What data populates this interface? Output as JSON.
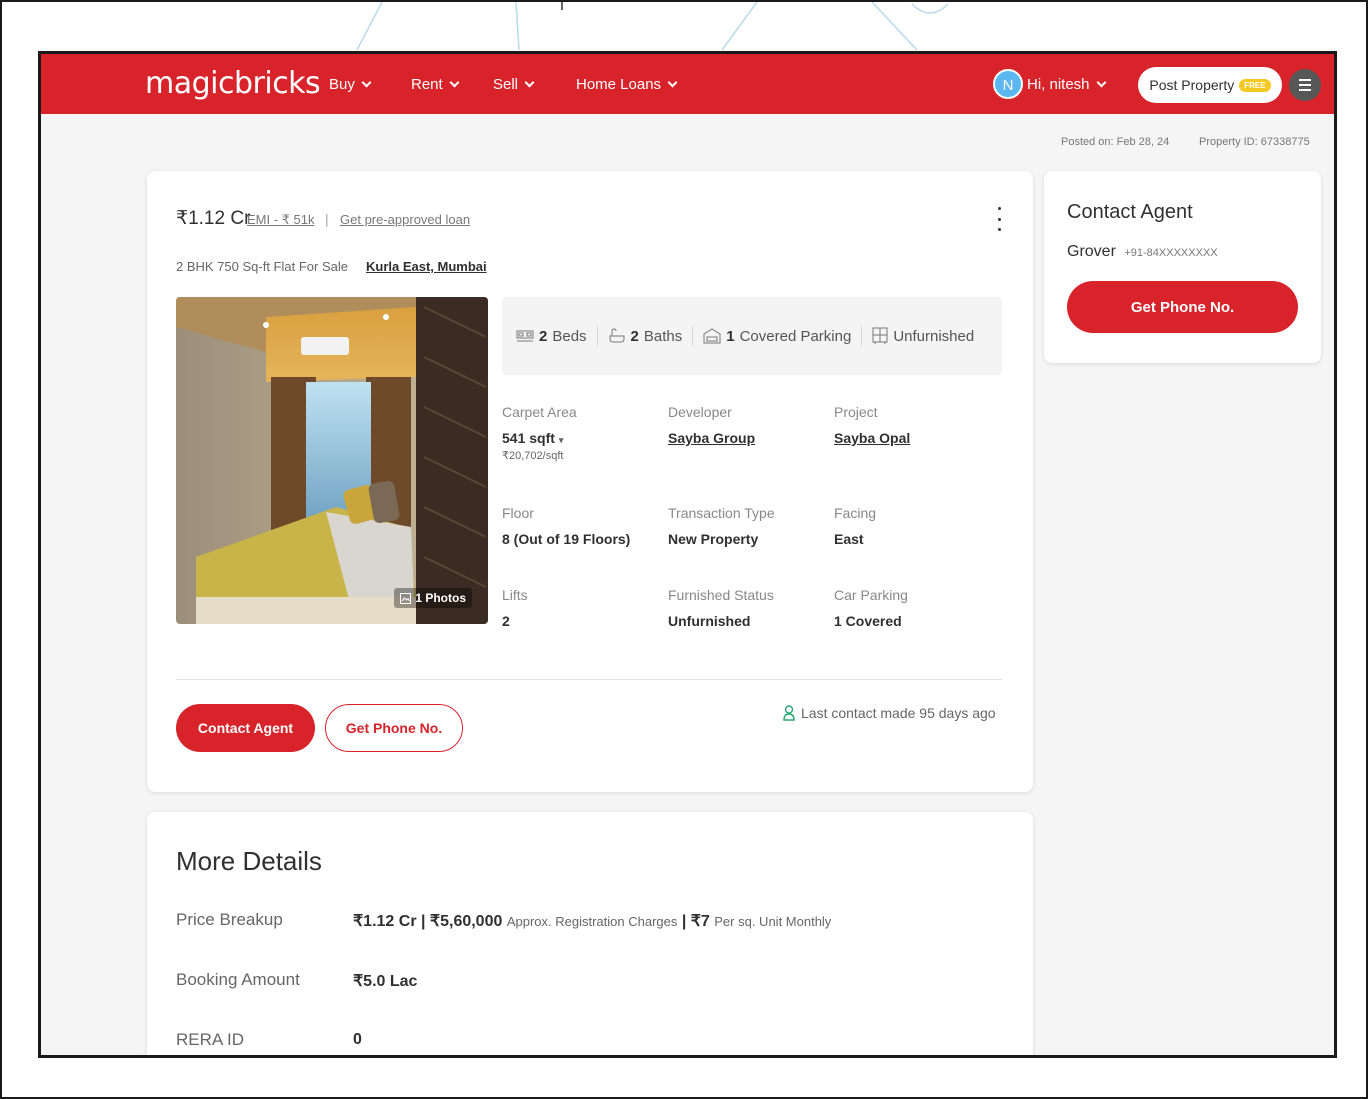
{
  "header": {
    "logo": "magicbricks",
    "nav": [
      "Buy",
      "Rent",
      "Sell",
      "Home Loans"
    ],
    "avatar_initial": "N",
    "greeting": "Hi, nitesh",
    "post_property": "Post Property",
    "free_badge": "FREE"
  },
  "meta": {
    "posted_on": "Posted on: Feb 28, 24",
    "property_id": "Property ID: 67338775"
  },
  "listing": {
    "price": "₹1.12 Cr",
    "emi": "EMI - ₹ 51k",
    "separator": "|",
    "loan_link": "Get pre-approved loan",
    "subtitle": "2 BHK 750 Sq-ft Flat For Sale",
    "locality": "Kurla East, Mumbai",
    "photos_badge": "1 Photos",
    "summary": {
      "beds_count": "2",
      "beds_label": "Beds",
      "baths_count": "2",
      "baths_label": "Baths",
      "parking_count": "1",
      "parking_label": "Covered Parking",
      "furnishing": "Unfurnished"
    },
    "attributes": {
      "carpet_area_label": "Carpet Area",
      "carpet_area_value": "541 sqft",
      "carpet_area_rate": "₹20,702/sqft",
      "developer_label": "Developer",
      "developer_value": "Sayba Group",
      "project_label": "Project",
      "project_value": "Sayba Opal",
      "floor_label": "Floor",
      "floor_value": "8 (Out of 19 Floors)",
      "transaction_label": "Transaction Type",
      "transaction_value": "New Property",
      "facing_label": "Facing",
      "facing_value": "East",
      "lifts_label": "Lifts",
      "lifts_value": "2",
      "furnished_label": "Furnished Status",
      "furnished_value": "Unfurnished",
      "car_parking_label": "Car Parking",
      "car_parking_value": "1 Covered"
    },
    "contact_agent_button": "Contact Agent",
    "get_phone_button": "Get Phone No.",
    "last_contact": "Last contact made 95 days ago"
  },
  "more_details": {
    "title": "More Details",
    "price_breakup_label": "Price Breakup",
    "price_breakup_price": "₹1.12 Cr | ₹5,60,000",
    "price_breakup_note": "Approx. Registration Charges",
    "price_breakup_maint": "| ₹7",
    "price_breakup_maint_note": "Per sq. Unit Monthly",
    "booking_label": "Booking Amount",
    "booking_value": "₹5.0 Lac",
    "rera_label": "RERA ID",
    "rera_value": "0"
  },
  "contact_card": {
    "title": "Contact Agent",
    "agent_name": "Grover",
    "agent_phone": "+91-84XXXXXXXX",
    "button": "Get Phone No."
  },
  "colors": {
    "brand_red": "#d8232a",
    "badge_yellow": "#f5c924",
    "avatar_blue": "#5bb7ef",
    "contact_green": "#2aa876"
  }
}
